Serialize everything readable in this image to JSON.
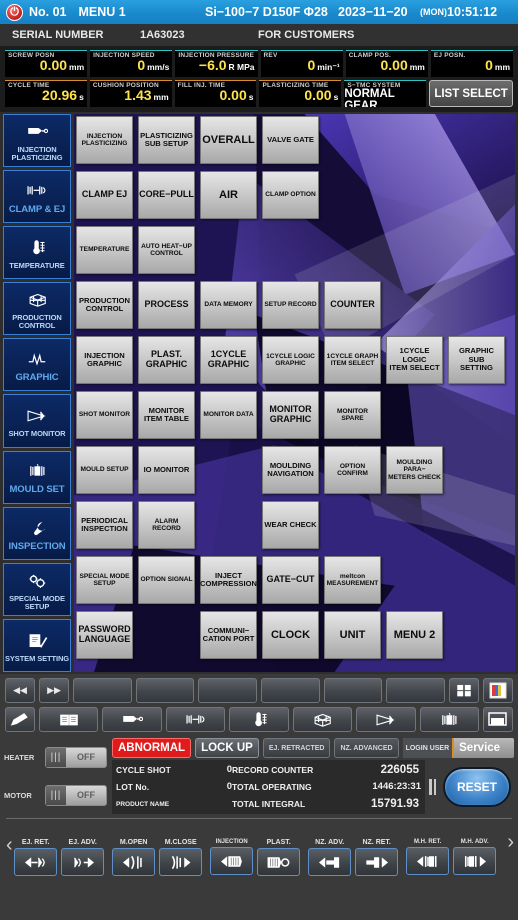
{
  "titlebar": {
    "power_icon": "power-icon",
    "machine_no": "No. 01",
    "menu": "MENU 1",
    "model": "Si−100−7  D150F  Φ28",
    "date": "2023−11−20",
    "day": "(MON)",
    "time": "10:51:12"
  },
  "serialbar": {
    "label": "SERIAL NUMBER",
    "value": "1A63023",
    "customers": "FOR CUSTOMERS"
  },
  "readouts": {
    "row1": [
      {
        "label": "SCREW POSN",
        "value": "0.00",
        "unit": "mm"
      },
      {
        "label": "INJECTION SPEED",
        "value": "0",
        "unit": "mm/s"
      },
      {
        "label": "INJECTION PRESSURE",
        "value": "−6.0",
        "unit": "R MPa"
      },
      {
        "label": "REV",
        "value": "0",
        "unit": "min⁻¹"
      },
      {
        "label": "CLAMP POS.",
        "value": "0.00",
        "unit": "mm"
      },
      {
        "label": "EJ POSN.",
        "value": "0",
        "unit": "mm"
      }
    ],
    "row2": [
      {
        "label": "CYCLE TIME",
        "value": "20.96",
        "unit": "s"
      },
      {
        "label": "CUSHION POSITION",
        "value": "1.43",
        "unit": "mm"
      },
      {
        "label": "FILL INJ. TIME",
        "value": "0.00",
        "unit": "s"
      },
      {
        "label": "PLASTICIZING TIME",
        "value": "0.00",
        "unit": "s"
      },
      {
        "label": "S−TMC SYSTEM",
        "value": "NORMAL GEAR",
        "unit": ""
      }
    ],
    "list_select": "LIST SELECT"
  },
  "sidebar": {
    "items": [
      {
        "label": "INJECTION\nPLASTICIZING",
        "icon": "injection-nozzle-icon",
        "big": false
      },
      {
        "label": "CLAMP & EJ",
        "icon": "clamp-icon",
        "big": true
      },
      {
        "label": "TEMPERATURE",
        "icon": "thermometer-icon",
        "big": false
      },
      {
        "label": "PRODUCTION\nCONTROL",
        "icon": "cube-grid-icon",
        "big": false
      },
      {
        "label": "GRAPHIC",
        "icon": "waveform-icon",
        "big": true
      },
      {
        "label": "SHOT MONITOR",
        "icon": "cone-monitor-icon",
        "big": false
      },
      {
        "label": "MOULD SET",
        "icon": "mould-icon",
        "big": true
      },
      {
        "label": "INSPECTION",
        "icon": "wrench-icon",
        "big": true
      },
      {
        "label": "SPECIAL MODE\nSETUP",
        "icon": "gears-icon",
        "big": false
      },
      {
        "label": "SYSTEM SETTING",
        "icon": "document-check-icon",
        "big": false
      }
    ]
  },
  "grid": {
    "buttons": [
      {
        "label": "INJECTION\nPLASTICIZING",
        "r": 0,
        "c": 0,
        "size": "xs"
      },
      {
        "label": "PLASTICIZING\nSUB SETUP",
        "r": 0,
        "c": 1,
        "size": "s"
      },
      {
        "label": "OVERALL",
        "r": 0,
        "c": 2,
        "size": "l"
      },
      {
        "label": "VALVE GATE",
        "r": 0,
        "c": 3,
        "size": "s"
      },
      {
        "label": "CLAMP  EJ",
        "r": 1,
        "c": 0,
        "size": "m"
      },
      {
        "label": "CORE−PULL",
        "r": 1,
        "c": 1,
        "size": "m"
      },
      {
        "label": "AIR",
        "r": 1,
        "c": 2,
        "size": "l"
      },
      {
        "label": "CLAMP OPTION",
        "r": 1,
        "c": 3,
        "size": "xs"
      },
      {
        "label": "TEMPERATURE",
        "r": 2,
        "c": 0,
        "size": "xs"
      },
      {
        "label": "AUTO HEAT−UP\nCONTROL",
        "r": 2,
        "c": 1,
        "size": "xs"
      },
      {
        "label": "PRODUCTION\nCONTROL",
        "r": 3,
        "c": 0,
        "size": "s"
      },
      {
        "label": "PROCESS",
        "r": 3,
        "c": 1,
        "size": "m"
      },
      {
        "label": "DATA MEMORY",
        "r": 3,
        "c": 2,
        "size": "xs"
      },
      {
        "label": "SETUP RECORD",
        "r": 3,
        "c": 3,
        "size": "xs"
      },
      {
        "label": "COUNTER",
        "r": 3,
        "c": 4,
        "size": "m"
      },
      {
        "label": "INJECTION\nGRAPHIC",
        "r": 4,
        "c": 0,
        "size": "s"
      },
      {
        "label": "PLAST.\nGRAPHIC",
        "r": 4,
        "c": 1,
        "size": "m"
      },
      {
        "label": "1CYCLE\nGRAPHIC",
        "r": 4,
        "c": 2,
        "size": "m"
      },
      {
        "label": "1CYCLE LOGIC\nGRAPHIC",
        "r": 4,
        "c": 3,
        "size": "xs"
      },
      {
        "label": "1CYCLE GRAPH\nITEM SELECT",
        "r": 4,
        "c": 4,
        "size": "xs"
      },
      {
        "label": "1CYCLE LOGIC\nITEM SELECT",
        "r": 4,
        "c": 5,
        "size": "s"
      },
      {
        "label": "GRAPHIC SUB\nSETTING",
        "r": 4,
        "c": 6,
        "size": "s"
      },
      {
        "label": "SHOT MONITOR",
        "r": 5,
        "c": 0,
        "size": "xs"
      },
      {
        "label": "MONITOR\nITEM TABLE",
        "r": 5,
        "c": 1,
        "size": "s"
      },
      {
        "label": "MONITOR DATA",
        "r": 5,
        "c": 2,
        "size": "xs"
      },
      {
        "label": "MONITOR\nGRAPHIC",
        "r": 5,
        "c": 3,
        "size": "m"
      },
      {
        "label": "MONITOR SPARE",
        "r": 5,
        "c": 4,
        "size": "xs"
      },
      {
        "label": "MOULD SETUP",
        "r": 6,
        "c": 0,
        "size": "xs"
      },
      {
        "label": "IO MONITOR",
        "r": 6,
        "c": 1,
        "size": "s"
      },
      {
        "label": "MOULDING\nNAVIGATION",
        "r": 6,
        "c": 3,
        "size": "s"
      },
      {
        "label": "OPTION CONFIRM",
        "r": 6,
        "c": 4,
        "size": "xs"
      },
      {
        "label": "MOULDING PARA−\nMETERS CHECK",
        "r": 6,
        "c": 5,
        "size": "xs"
      },
      {
        "label": "PERIODICAL\nINSPECTION",
        "r": 7,
        "c": 0,
        "size": "s"
      },
      {
        "label": "ALARM RECORD",
        "r": 7,
        "c": 1,
        "size": "xs"
      },
      {
        "label": "WEAR CHECK",
        "r": 7,
        "c": 3,
        "size": "s"
      },
      {
        "label": "SPECIAL MODE\nSETUP",
        "r": 8,
        "c": 0,
        "size": "xs"
      },
      {
        "label": "OPTION SIGNAL",
        "r": 8,
        "c": 1,
        "size": "xs"
      },
      {
        "label": "INJECT\nCOMPRESSION",
        "r": 8,
        "c": 2,
        "size": "s"
      },
      {
        "label": "GATE−CUT",
        "r": 8,
        "c": 3,
        "size": "m"
      },
      {
        "label": "meltcon\nMEASUREMENT",
        "r": 8,
        "c": 4,
        "size": "xs"
      },
      {
        "label": "PASSWORD\nLANGUAGE",
        "r": 9,
        "c": 0,
        "size": "m"
      },
      {
        "label": "COMMUNI−\nCATION PORT",
        "r": 9,
        "c": 2,
        "size": "s"
      },
      {
        "label": "CLOCK",
        "r": 9,
        "c": 3,
        "size": "l"
      },
      {
        "label": "UNIT",
        "r": 9,
        "c": 4,
        "size": "l"
      },
      {
        "label": "MENU 2",
        "r": 9,
        "c": 5,
        "size": "l"
      }
    ]
  },
  "toolbar": {
    "row1": [
      {
        "icon": "rewind-icon",
        "glyph": "◀◀",
        "small": true
      },
      {
        "icon": "forward-icon",
        "glyph": "▶▶",
        "small": true
      },
      {
        "icon": "blank-key-1",
        "glyph": "",
        "small": false
      },
      {
        "icon": "blank-key-2",
        "glyph": "",
        "small": false
      },
      {
        "icon": "blank-key-3",
        "glyph": "",
        "small": false
      },
      {
        "icon": "blank-key-4",
        "glyph": "",
        "small": false
      },
      {
        "icon": "blank-key-5",
        "glyph": "",
        "small": false
      },
      {
        "icon": "blank-key-6",
        "glyph": "",
        "small": false
      },
      {
        "icon": "grid-menu-icon",
        "glyph": "",
        "small": true
      },
      {
        "icon": "color-page-icon",
        "glyph": "",
        "small": true
      }
    ],
    "row2": [
      {
        "icon": "pencil-icon",
        "glyph": "",
        "small": true
      },
      {
        "icon": "book-icon",
        "glyph": "",
        "small": false
      },
      {
        "icon": "injection-nozzle-icon",
        "glyph": "",
        "small": false
      },
      {
        "icon": "clamp-icon",
        "glyph": "",
        "small": false
      },
      {
        "icon": "thermometer-icon",
        "glyph": "",
        "small": false
      },
      {
        "icon": "cube-grid-icon",
        "glyph": "",
        "small": false
      },
      {
        "icon": "cone-monitor-icon",
        "glyph": "",
        "small": false
      },
      {
        "icon": "mould-icon",
        "glyph": "",
        "small": false
      },
      {
        "icon": "window-icon",
        "glyph": "",
        "small": true
      }
    ]
  },
  "status": {
    "heater": {
      "label": "HEATER",
      "state": "OFF"
    },
    "motor": {
      "label": "MOTOR",
      "state": "OFF"
    },
    "badges": {
      "alarm": "ABNORMAL",
      "lock": "LOCK UP",
      "ej": "EJ. RETRACTED",
      "nz": "NZ. ADVANCED",
      "login_label": "LOGIN USER",
      "login_user": "Service"
    },
    "counters": {
      "cycle_shot_label": "CYCLE SHOT",
      "cycle_shot_value": "0",
      "lot_no_label": "LOT No.",
      "lot_no_value": "0",
      "product_name_label": "PRODUCT NAME",
      "record_counter_label": "RECORD COUNTER",
      "record_counter_value": "226055",
      "total_operating_label": "TOTAL OPERATING",
      "total_operating_value": "1446:23:31",
      "total_integral_label": "TOTAL INTEGRAL",
      "total_integral_value": "15791.93"
    },
    "reset": "RESET"
  },
  "footer": {
    "nav_left": "‹",
    "nav_right": "›",
    "groups": [
      {
        "keys": [
          {
            "label": "EJ. RET.",
            "icon": "ejector-retract-icon"
          },
          {
            "label": "EJ. ADV.",
            "icon": "ejector-advance-icon"
          }
        ]
      },
      {
        "keys": [
          {
            "label": "M.OPEN",
            "icon": "mould-open-icon"
          },
          {
            "label": "M.CLOSE",
            "icon": "mould-close-icon"
          }
        ]
      },
      {
        "keys": [
          {
            "label": "INJECTION",
            "icon": "injection-icon"
          },
          {
            "label": "PLAST.",
            "icon": "plasticizing-icon"
          }
        ]
      },
      {
        "keys": [
          {
            "label": "NZ. ADV.",
            "icon": "nozzle-advance-icon"
          },
          {
            "label": "NZ. RET.",
            "icon": "nozzle-retract-icon"
          }
        ]
      },
      {
        "keys": [
          {
            "label": "M.H. RET.",
            "icon": "mould-height-retract-icon"
          },
          {
            "label": "M.H. ADV.",
            "icon": "mould-height-advance-icon"
          }
        ]
      }
    ]
  },
  "colors": {
    "titlebar": "#1b8ccd",
    "alarm": "#e01b1b",
    "accent_teal": "#2ec4c4",
    "accent_orange": "#d98c2b",
    "value_yellow": "#ffe34d",
    "sidebar_blue": "#0d2a66"
  }
}
